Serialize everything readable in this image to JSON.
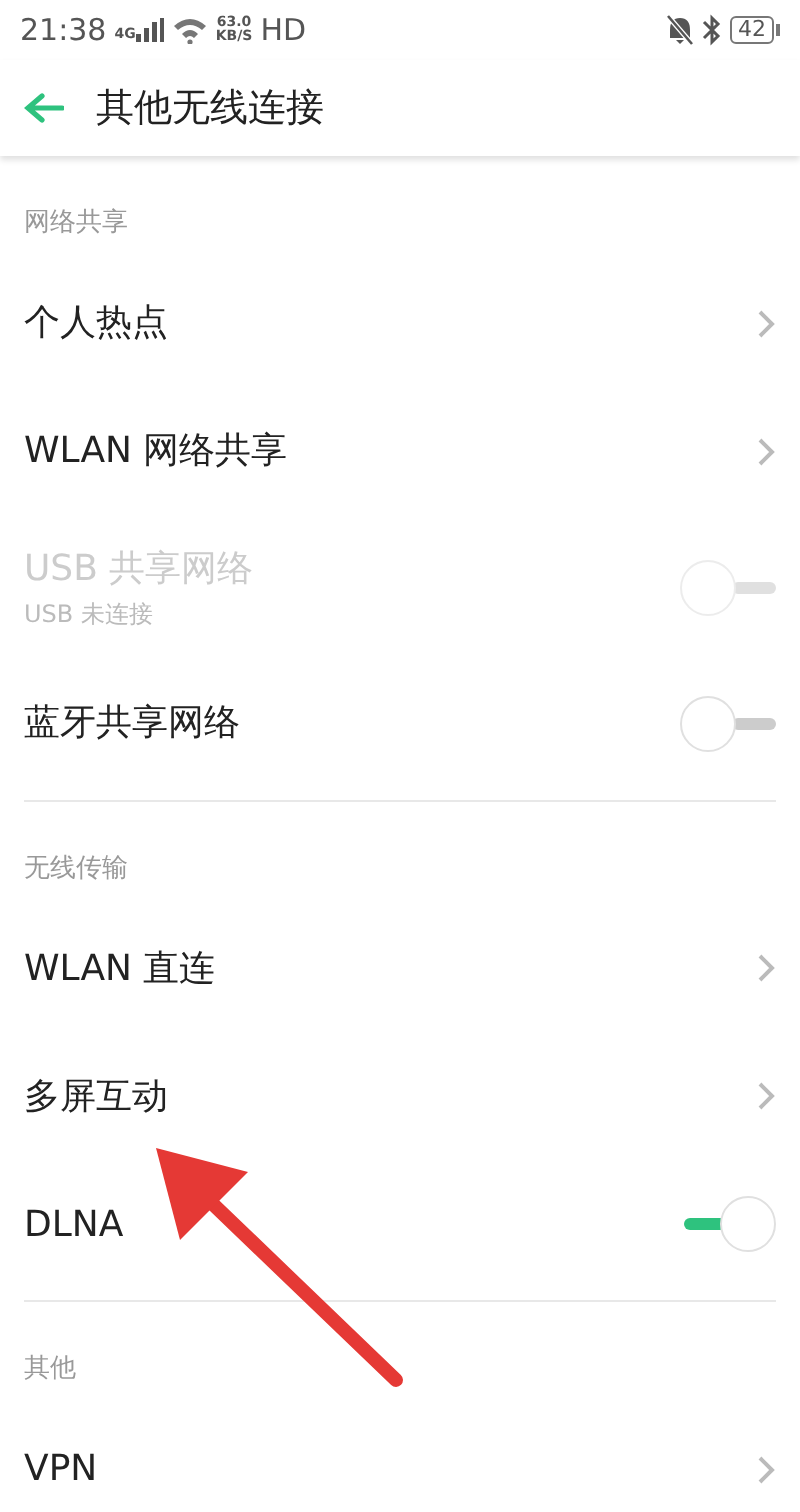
{
  "status_bar": {
    "time": "21:38",
    "network": "4G",
    "speed_value": "63.0",
    "speed_unit": "KB/S",
    "hd": "HD",
    "battery": "42"
  },
  "header": {
    "title": "其他无线连接"
  },
  "sections": [
    {
      "title": "网络共享",
      "items": [
        {
          "kind": "link",
          "label": "个人热点",
          "disabled": false
        },
        {
          "kind": "link",
          "label": "WLAN 网络共享",
          "disabled": false
        },
        {
          "kind": "toggle",
          "label": "USB 共享网络",
          "subtitle": "USB 未连接",
          "disabled": true,
          "on": false
        },
        {
          "kind": "toggle",
          "label": "蓝牙共享网络",
          "disabled": false,
          "on": false
        }
      ]
    },
    {
      "title": "无线传输",
      "items": [
        {
          "kind": "link",
          "label": "WLAN 直连",
          "disabled": false
        },
        {
          "kind": "link",
          "label": "多屏互动",
          "disabled": false
        },
        {
          "kind": "toggle",
          "label": "DLNA",
          "disabled": false,
          "on": true
        }
      ]
    },
    {
      "title": "其他",
      "items": [
        {
          "kind": "link",
          "label": "VPN",
          "disabled": false
        }
      ]
    }
  ]
}
